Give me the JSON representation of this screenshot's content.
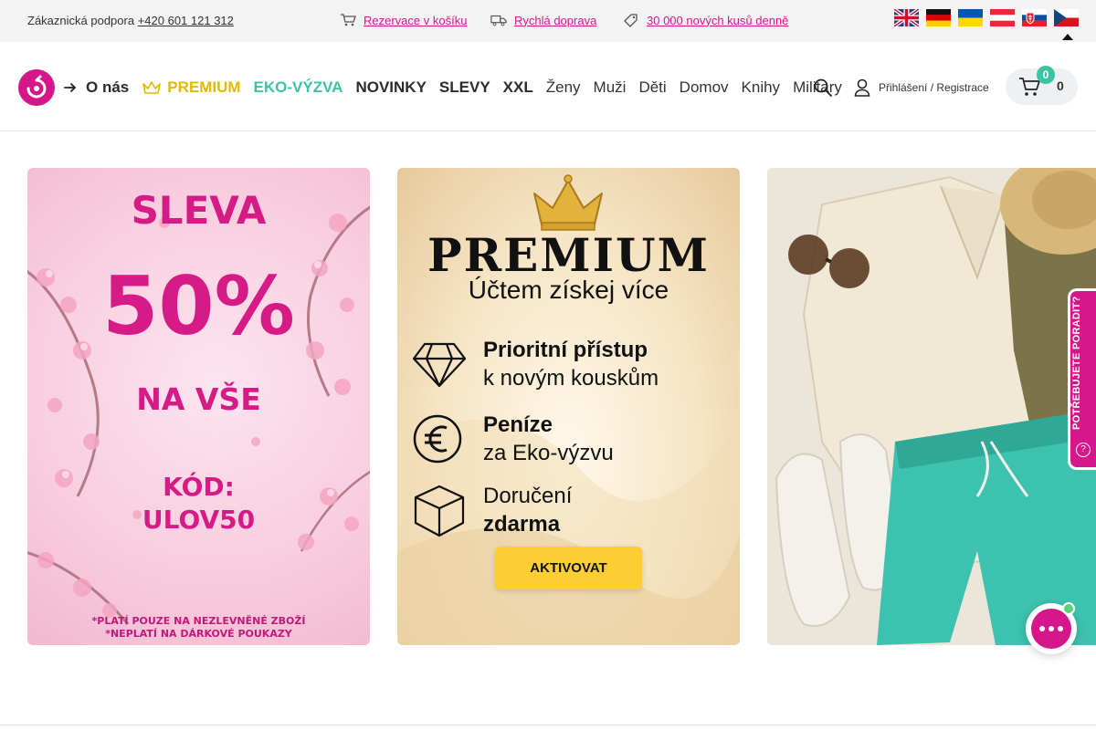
{
  "topbar": {
    "support_label": "Zákaznická podpora",
    "support_phone": "+420 601 121 312",
    "features": [
      {
        "icon": "cart-icon",
        "label": "Rezervace v košíku"
      },
      {
        "icon": "truck-icon",
        "label": "Rychlá doprava"
      },
      {
        "icon": "tag-icon",
        "label": "30 000 nových kusů denně"
      }
    ],
    "languages": [
      "en",
      "de",
      "ua",
      "at",
      "sk",
      "cz"
    ]
  },
  "header": {
    "nav": {
      "about": "O nás",
      "premium": "PREMIUM",
      "eco": "EKO-VÝZVA",
      "novinky": "NOVINKY",
      "slevy": "SLEVY",
      "xxl": "XXL",
      "zeny": "Ženy",
      "muzi": "Muži",
      "deti": "Děti",
      "domov": "Domov",
      "knihy": "Knihy",
      "military": "Military"
    },
    "login_label": "Přihlášení / Registrace",
    "cart_badge": "0",
    "cart_count": "0"
  },
  "banners": {
    "sale": {
      "line1": "SLEVA",
      "line2": "50%",
      "line3": "NA VŠE",
      "code_label": "KÓD:",
      "code": "ULOV50",
      "note1": "*PLATÍ POUZE NA NEZLEVNĚNÉ ZBOŽÍ",
      "note2": "*NEPLATÍ NA DÁRKOVÉ POUKAZY"
    },
    "premium": {
      "title": "PREMIUM",
      "subtitle": "Účtem získej více",
      "benefit1_a": "Prioritní přístup",
      "benefit1_b": "k novým kouskům",
      "benefit2_a": "Peníze",
      "benefit2_b": "za Eko-výzvu",
      "benefit3_a": "Doručení",
      "benefit3_b": "zdarma",
      "button": "AKTIVOVAT"
    }
  },
  "help_tab": "POTŘEBUJETE PORADIT?",
  "colors": {
    "brand": "#d6168b",
    "eco": "#3cc3a5",
    "premium": "#e5b800",
    "button": "#fcce33"
  }
}
